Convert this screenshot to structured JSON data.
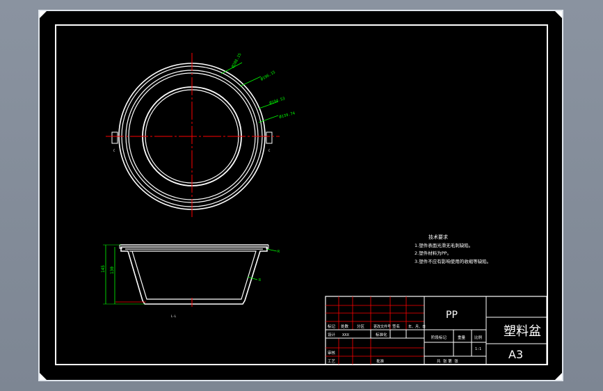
{
  "dimensions": {
    "d1": "Ø208.15",
    "d2": "Ø196.15",
    "d3": "Ø194.53",
    "d4": "Ø139.74",
    "h1": "145",
    "h2": "130",
    "side1": "R",
    "side2": "R"
  },
  "tech": {
    "title": "技术要求",
    "line1": "1.塑件表面光滑无毛刺缺陷。",
    "line2": "2.塑件材料为PP。",
    "line3": "3.塑件不应有影响使用的收缩等缺陷。"
  },
  "title_block": {
    "material": "PP",
    "part_name": "塑料盆",
    "sheet_size": "A3",
    "scale_value": "1:1",
    "header_row": [
      "标记",
      "处数",
      "分区",
      "更改文件号",
      "签名",
      "年、月、日"
    ],
    "design_label": "设计",
    "designer": "XXX",
    "standardize": "标准化",
    "stage_mark": "阶段标记",
    "weight": "重量",
    "scale": "比例",
    "review": "审核",
    "process": "工艺",
    "approve": "批准",
    "sheets": "共  张 第  张"
  },
  "colors": {
    "sheet_bg": "#000000",
    "line": "#ffffff",
    "center": "#ff0000",
    "dim": "#00ff00"
  }
}
